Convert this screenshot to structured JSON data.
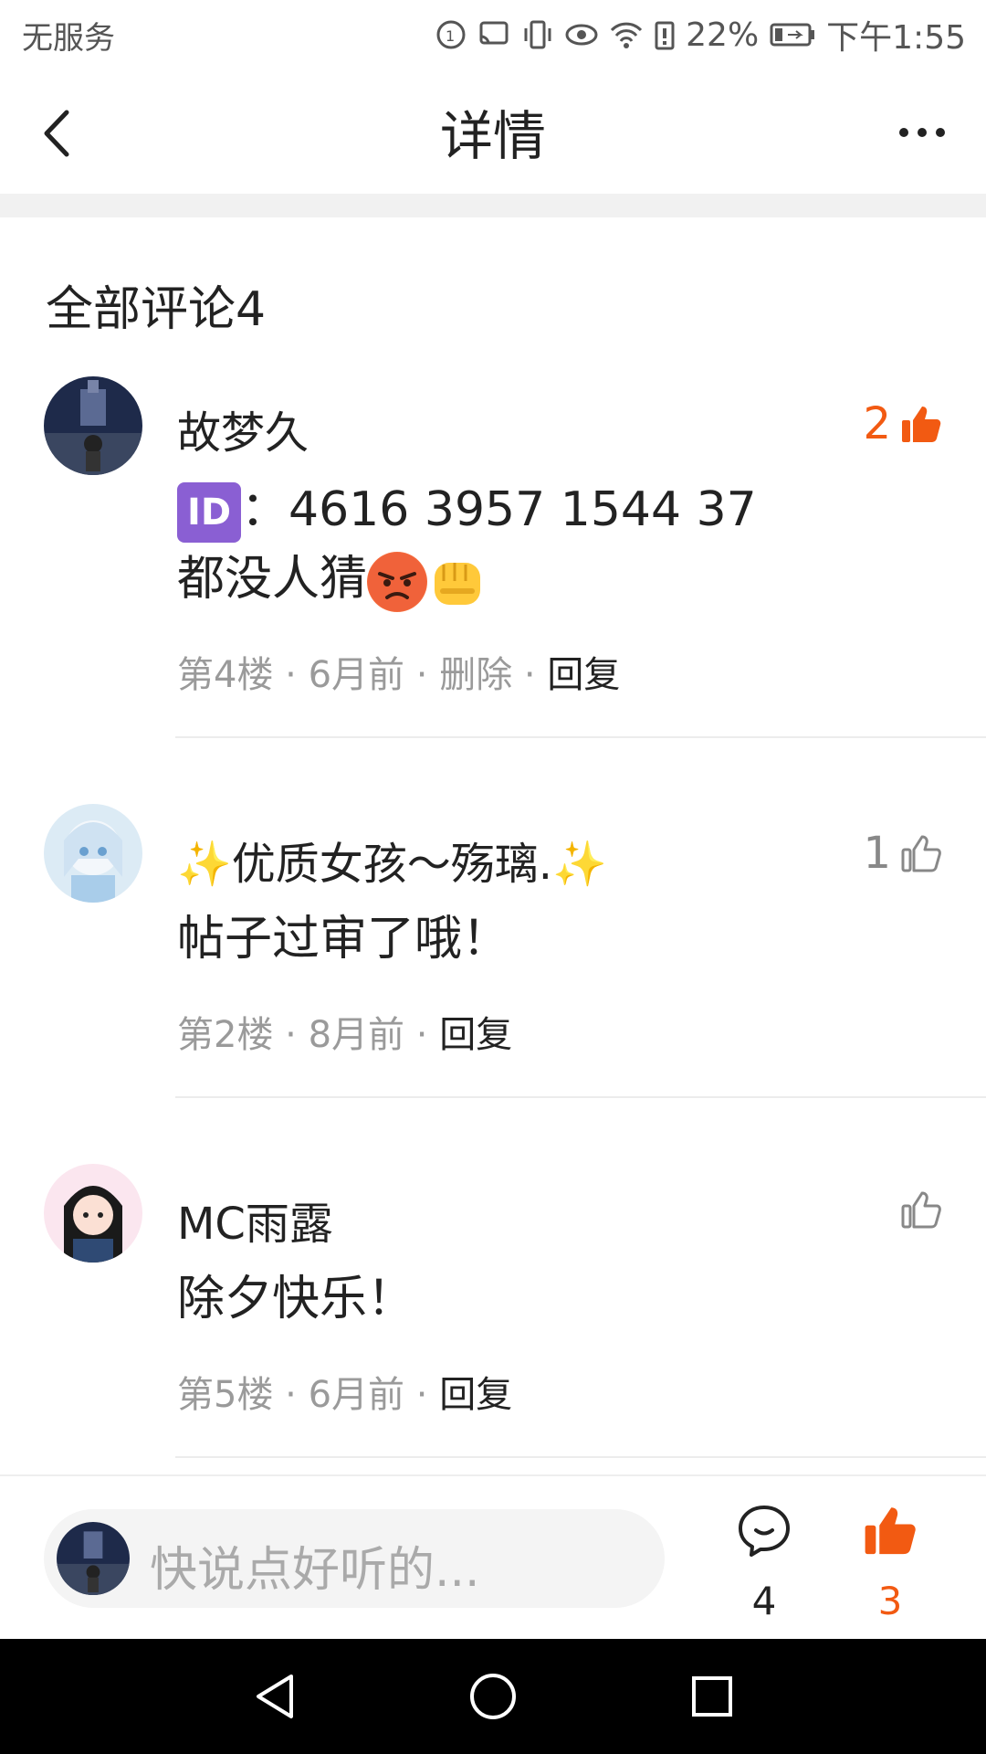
{
  "status_bar": {
    "carrier": "无服务",
    "battery": "22%",
    "time": "下午1:55"
  },
  "header": {
    "title": "详情",
    "back_icon": "back-arrow-icon",
    "more_icon": "more-dots-icon"
  },
  "comments_section": {
    "heading": "全部评论4",
    "comments": [
      {
        "author": "故梦久",
        "likes": "2",
        "liked": true,
        "id_label": "ID",
        "body_line1": "：4616 3957 1544 37",
        "body_line2": "都没人猜",
        "floor": "第4楼",
        "time": "6月前",
        "delete": "删除",
        "reply": "回复"
      },
      {
        "author": "✨优质女孩～殇璃.✨",
        "likes": "1",
        "liked": false,
        "body_line1": "帖子过审了哦！",
        "floor": "第2楼",
        "time": "8月前",
        "reply": "回复"
      },
      {
        "author": "MC雨露",
        "likes": "",
        "liked": false,
        "body_line1": "除夕快乐！",
        "floor": "第5楼",
        "time": "6月前",
        "reply": "回复"
      }
    ]
  },
  "bottom_bar": {
    "input_placeholder": "快说点好听的...",
    "comment_count": "4",
    "like_count": "3"
  },
  "colors": {
    "accent": "#f25a12",
    "text": "#222222",
    "muted": "#9a9a9a"
  }
}
